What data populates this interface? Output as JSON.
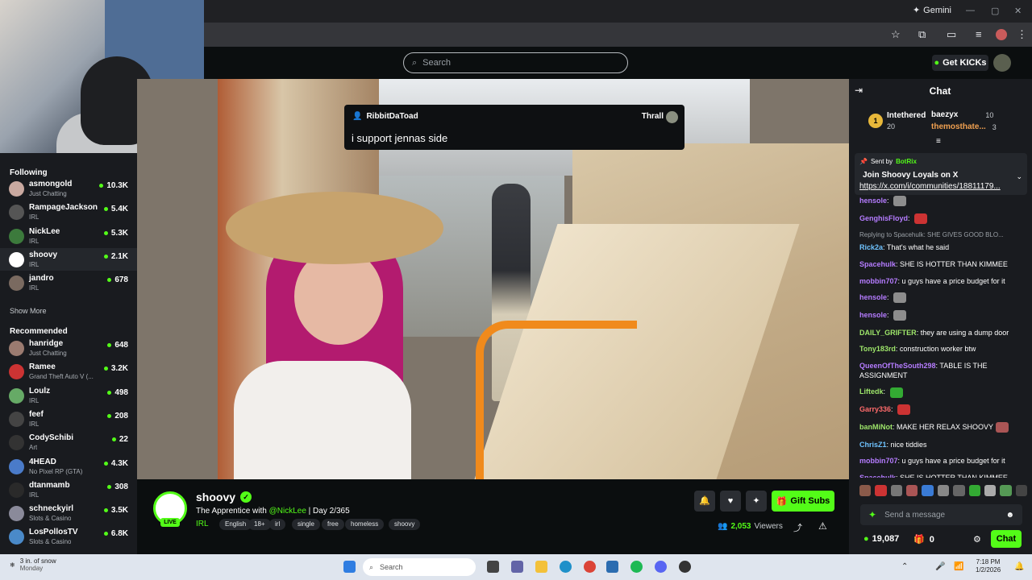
{
  "browser": {
    "gemini_label": "Gemini"
  },
  "header": {
    "search_placeholder": "Search",
    "get_kicks": "Get KICKs"
  },
  "sidebar": {
    "following_title": "Following",
    "following": [
      {
        "name": "asmongold",
        "category": "Just Chatting",
        "viewers": "10.3K",
        "avatar_color": "#c9a9a0"
      },
      {
        "name": "RampageJackson",
        "category": "IRL",
        "viewers": "5.4K",
        "avatar_color": "#555"
      },
      {
        "name": "NickLee",
        "category": "IRL",
        "viewers": "5.3K",
        "avatar_color": "#3c7a3c"
      },
      {
        "name": "shoovy",
        "category": "IRL",
        "viewers": "2.1K",
        "avatar_color": "#ffffff"
      },
      {
        "name": "jandro",
        "category": "IRL",
        "viewers": "678",
        "avatar_color": "#7a6a60"
      }
    ],
    "show_more": "Show More",
    "recommended_title": "Recommended",
    "recommended": [
      {
        "name": "hanridge",
        "category": "Just Chatting",
        "viewers": "648",
        "avatar_color": "#9b7b70"
      },
      {
        "name": "Ramee",
        "category": "Grand Theft Auto V (...",
        "viewers": "3.2K",
        "avatar_color": "#c33"
      },
      {
        "name": "Loulz",
        "category": "IRL",
        "viewers": "498",
        "avatar_color": "#6a6"
      },
      {
        "name": "feef",
        "category": "IRL",
        "viewers": "208",
        "avatar_color": "#444"
      },
      {
        "name": "CodySchibi",
        "category": "Art",
        "viewers": "22",
        "avatar_color": "#333"
      },
      {
        "name": "4HEAD",
        "category": "No Pixel RP (GTA)",
        "viewers": "4.3K",
        "avatar_color": "#4a7bc9"
      },
      {
        "name": "dtanmamb",
        "category": "IRL",
        "viewers": "308",
        "avatar_color": "#2a2a2a"
      },
      {
        "name": "schneckyirl",
        "category": "Slots & Casino",
        "viewers": "3.5K",
        "avatar_color": "#8a8a9a"
      },
      {
        "name": "LosPollosTV",
        "category": "Slots & Casino",
        "viewers": "6.8K",
        "avatar_color": "#4a8ac9"
      }
    ]
  },
  "popup": {
    "user": "RibbitDaToad",
    "mod": "Thrall",
    "message": "i support jennas side"
  },
  "stream": {
    "name": "shoovy",
    "live": "LIVE",
    "title_pre": "The Apprentice with ",
    "title_mention": "@NickLee",
    "title_post": " | Day 2/365",
    "category": "IRL",
    "tags": [
      "English",
      "18+",
      "irl",
      "single",
      "free",
      "homeless",
      "shoovy"
    ],
    "gift_subs": "Gift Subs",
    "viewers": "2,053",
    "viewers_label": "Viewers"
  },
  "chat": {
    "title": "Chat",
    "leaders": [
      {
        "rank": "1",
        "name": "Intethered",
        "count": "20"
      },
      {
        "name": "baezyx",
        "count": "10"
      },
      {
        "name": "themosthate...",
        "count": "3"
      }
    ],
    "pinned": {
      "sent_by": "Sent by",
      "bot": "BotRix",
      "text": "Join Shoovy Loyals on X",
      "link": "https://x.com/i/communities/18811179..."
    },
    "messages": [
      {
        "user": "hensole",
        "text": "",
        "color": "#b57cff",
        "emote": "#8d8d8d"
      },
      {
        "user": "GenghisFloyd",
        "text": "",
        "color": "#b57cff",
        "emote": "#c33"
      },
      {
        "reply": "Replying to Spacehulk: SHE GIVES GOOD BLO..."
      },
      {
        "user": "Rick2a",
        "text": "That's what he said",
        "color": "#6fc3ff"
      },
      {
        "user": "Spacehulk",
        "text": "SHE IS HOTTER THAN KIMMEE",
        "color": "#b57cff"
      },
      {
        "user": "mobbin707",
        "text": "u guys have a price budget for it",
        "color": "#b57cff"
      },
      {
        "user": "hensole",
        "text": "",
        "color": "#b57cff",
        "emote": "#8d8d8d"
      },
      {
        "user": "hensole",
        "text": "",
        "color": "#b57cff",
        "emote": "#8d8d8d"
      },
      {
        "user": "DAILY_GRIFTER",
        "text": "they are using a dump door",
        "color": "#9ee66a"
      },
      {
        "user": "Tony183rd",
        "text": "construction worker btw",
        "color": "#9ee66a"
      },
      {
        "user": "QueenOfTheSouth298",
        "text": "TABLE IS THE ASSIGNMENT",
        "color": "#b57cff"
      },
      {
        "user": "Liftedk",
        "text": "",
        "color": "#9ee66a",
        "emote": "#3a3"
      },
      {
        "user": "Garry336",
        "text": "",
        "color": "#ff6b6b",
        "emote": "#c33"
      },
      {
        "user": "banMiNot",
        "text": "MAKE HER RELAX SHOOVY",
        "color": "#9ee66a",
        "emote": "#a55"
      },
      {
        "user": "ChrisZ1",
        "text": "nice tiddies",
        "color": "#6fc3ff"
      },
      {
        "user": "mobbin707",
        "text": "u guys have a price budget for it",
        "color": "#b57cff"
      },
      {
        "user": "Spacehulk",
        "text": "SHE IS HOTTER THAN KIMMEE",
        "color": "#b57cff"
      }
    ],
    "send_placeholder": "Send a message",
    "kicks": "19,087",
    "subs": "0",
    "chat_button": "Chat"
  },
  "taskbar": {
    "weather_temp": "3 in. of snow",
    "weather_day": "Monday",
    "search": "Search",
    "time": "7:18 PM",
    "date": "1/2/2026"
  }
}
